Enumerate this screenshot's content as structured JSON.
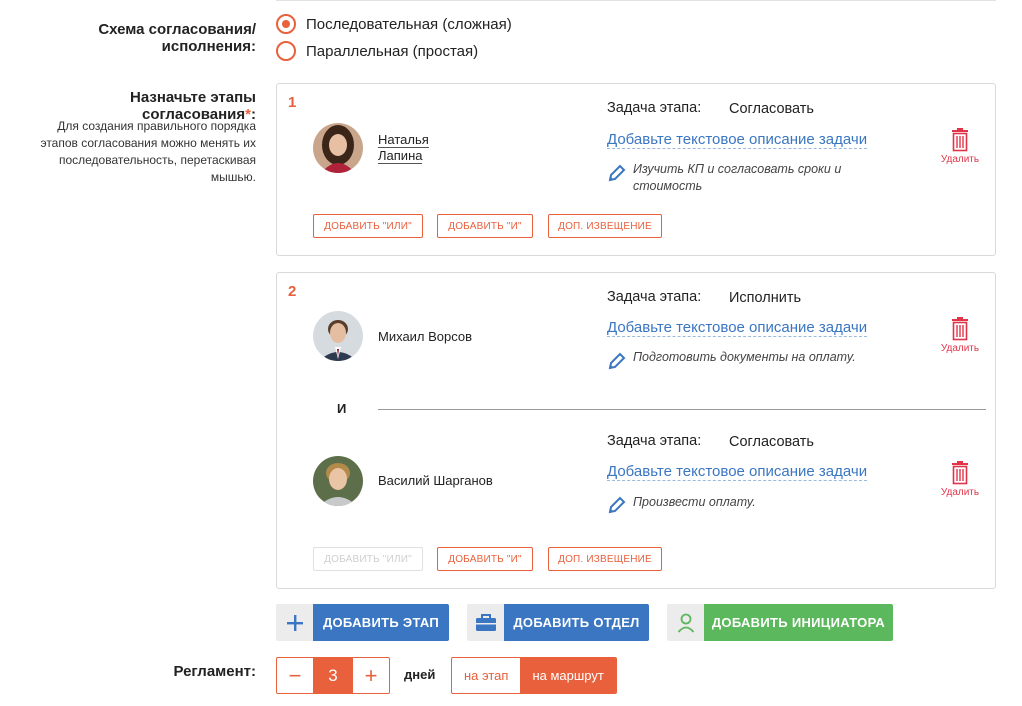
{
  "scheme": {
    "label": "Схема согласования/исполнения:",
    "options": [
      {
        "label": "Последовательная (сложная)",
        "checked": true
      },
      {
        "label": "Параллельная (простая)",
        "checked": false
      }
    ]
  },
  "stages_section": {
    "label": "Назначьте этапы согласования",
    "required_mark": "*",
    "label_suffix": ":",
    "help": "Для создания правильного порядка этапов согласования можно менять их последовательность, перетаскивая мышью."
  },
  "stages": [
    {
      "number": "1",
      "assignees": [
        {
          "name_line1": "Наталья",
          "name_line2": "Лапина",
          "task_label": "Задача этапа:",
          "task_value": "Согласовать",
          "task_desc_link": "Добавьте текстовое описание задачи",
          "task_note": "Изучить КП и согласовать сроки и стоимость",
          "delete_label": "Удалить"
        }
      ],
      "buttons": {
        "or": "ДОБАВИТЬ \"ИЛИ\"",
        "and": "ДОБАВИТЬ \"И\"",
        "notify": "ДОП. ИЗВЕЩЕНИЕ"
      }
    },
    {
      "number": "2",
      "joiner": "И",
      "assignees": [
        {
          "name": "Михаил Ворсов",
          "task_label": "Задача этапа:",
          "task_value": "Исполнить",
          "task_desc_link": "Добавьте текстовое описание задачи",
          "task_note": "Подготовить документы на оплату.",
          "delete_label": "Удалить"
        },
        {
          "name": "Василий Шарганов",
          "task_label": "Задача этапа:",
          "task_value": "Согласовать",
          "task_desc_link": "Добавьте текстовое описание задачи",
          "task_note": "Произвести оплату.",
          "delete_label": "Удалить"
        }
      ],
      "buttons": {
        "or": "ДОБАВИТЬ \"ИЛИ\"",
        "and": "ДОБАВИТЬ \"И\"",
        "notify": "ДОП. ИЗВЕЩЕНИЕ"
      }
    }
  ],
  "actions": {
    "add_stage": "ДОБАВИТЬ ЭТАП",
    "add_department": "ДОБАВИТЬ ОТДЕЛ",
    "add_initiator": "ДОБАВИТЬ ИНИЦИАТОРА"
  },
  "regulation": {
    "label": "Регламент:",
    "minus": "−",
    "value": "3",
    "plus": "+",
    "unit": "дней",
    "options": [
      "на этап",
      "на маршрут"
    ],
    "selected": "на маршрут"
  },
  "colors": {
    "accent": "#e8603c",
    "blue": "#3a76c2",
    "green": "#5cb85c",
    "delete": "#e03448"
  },
  "icons": [
    "pencil-icon",
    "trash-icon",
    "plus-icon",
    "briefcase-icon",
    "person-icon"
  ]
}
